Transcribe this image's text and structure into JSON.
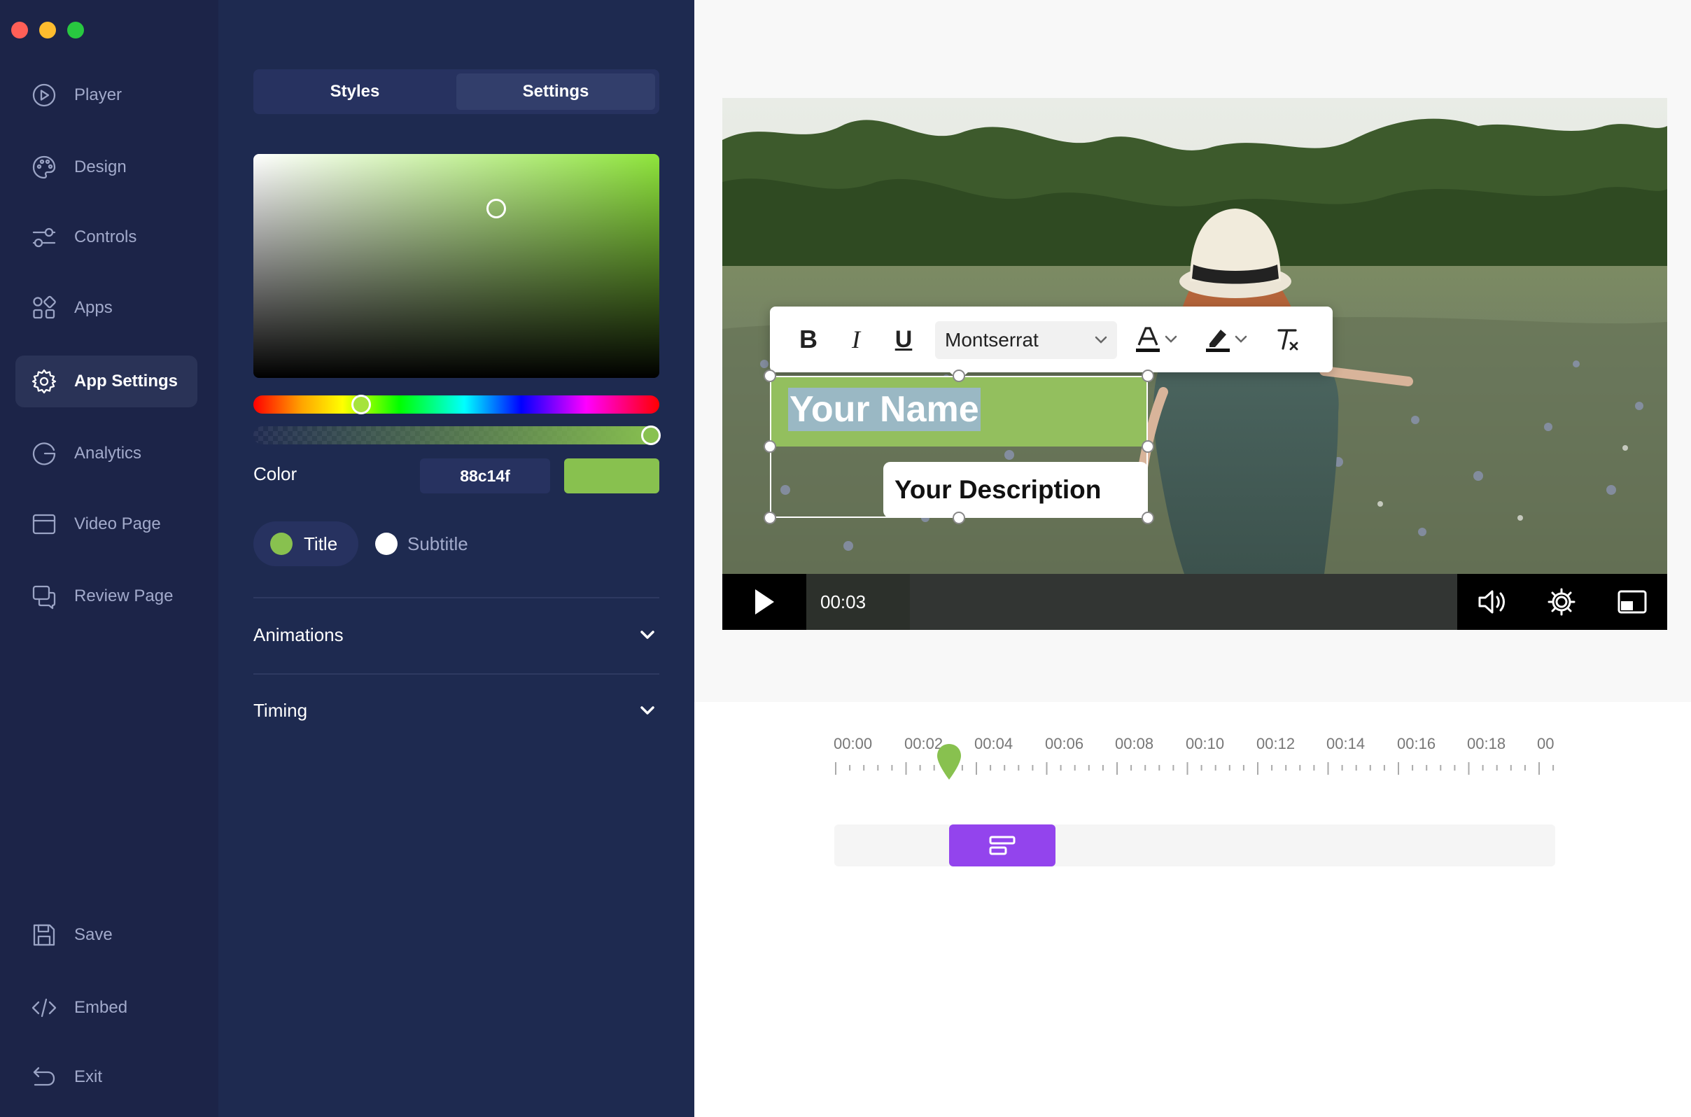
{
  "window": {
    "traffic_colors": [
      "#ff5f57",
      "#febc2e",
      "#28c840"
    ]
  },
  "sidebar": {
    "items": [
      {
        "label": "Player",
        "icon": "play-circle-icon"
      },
      {
        "label": "Design",
        "icon": "palette-icon"
      },
      {
        "label": "Controls",
        "icon": "sliders-icon"
      },
      {
        "label": "Apps",
        "icon": "apps-grid-icon"
      },
      {
        "label": "App Settings",
        "icon": "gear-icon",
        "active": true
      },
      {
        "label": "Analytics",
        "icon": "analytics-icon"
      },
      {
        "label": "Video Page",
        "icon": "browser-window-icon"
      },
      {
        "label": "Review Page",
        "icon": "review-chat-icon"
      }
    ],
    "bottom_items": [
      {
        "label": "Save",
        "icon": "floppy-disk-icon"
      },
      {
        "label": "Embed",
        "icon": "code-icon"
      },
      {
        "label": "Exit",
        "icon": "undo-arrow-icon"
      }
    ]
  },
  "panel": {
    "tabs": [
      "Styles",
      "Settings"
    ],
    "active_tab": "Settings",
    "color_label": "Color",
    "color_hex": "88c14f",
    "color_value": "#88c14f",
    "targets": [
      "Title",
      "Subtitle"
    ],
    "active_target": "Title",
    "sections": [
      "Animations",
      "Timing"
    ]
  },
  "editor": {
    "font": "Montserrat",
    "title_text": "Your Name",
    "description_text": "Your Description"
  },
  "player": {
    "time": "00:03"
  },
  "timeline": {
    "ticks": [
      "00:00",
      "00:02",
      "00:04",
      "00:06",
      "00:08",
      "00:10",
      "00:12",
      "00:14",
      "00:16",
      "00:18",
      "00"
    ]
  }
}
